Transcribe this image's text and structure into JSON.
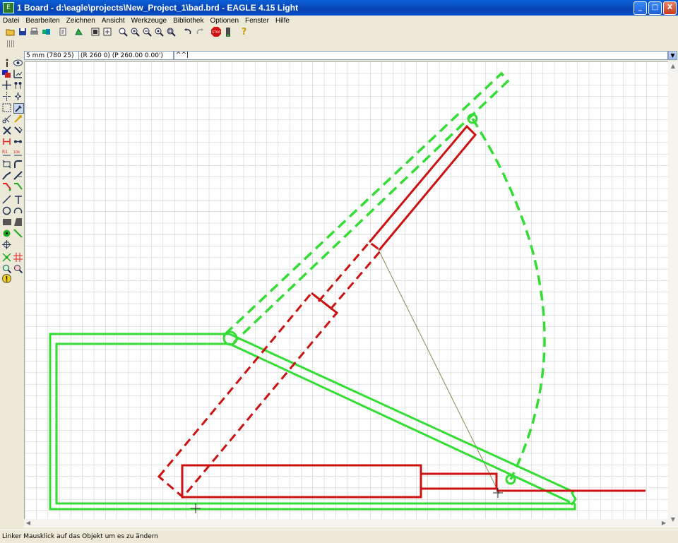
{
  "window": {
    "title": "1 Board - d:\\eagle\\projects\\New_Project_1\\bad.brd - EAGLE 4.15 Light",
    "app_icon": "eagle-icon"
  },
  "window_buttons": {
    "minimize": "_",
    "maximize": "□",
    "close": "X"
  },
  "menu": [
    "Datei",
    "Bearbeiten",
    "Zeichnen",
    "Ansicht",
    "Werkzeuge",
    "Bibliothek",
    "Optionen",
    "Fenster",
    "Hilfe"
  ],
  "toolbar_icons": [
    "open-icon",
    "save-icon",
    "print-icon",
    "cam-icon",
    "script-icon",
    "ulp-icon",
    "board-icon",
    "schematic-icon",
    "zoom-fit-icon",
    "zoom-in-icon",
    "zoom-out-icon",
    "zoom-redraw-icon",
    "zoom-select-icon",
    "undo-icon",
    "redo-icon",
    "stop-icon",
    "go-icon",
    "help-icon"
  ],
  "stop_label": "STOP",
  "help_glyph": "?",
  "coordinate_bar": {
    "grid": "5 mm (780 25)",
    "position": "(R 260 0) (P 260.00 0.00')",
    "command": "^^|"
  },
  "status": "Linker Mausklick auf das Objekt um es zu ändern",
  "colors": {
    "green": "#33dd33",
    "red": "#cc1111",
    "grid": "#c8c8c8",
    "titlebar": "#0a4fc8"
  }
}
